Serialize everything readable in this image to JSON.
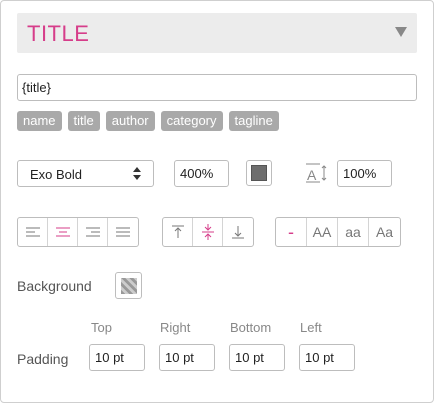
{
  "header": {
    "title": "TITLE"
  },
  "text_field": {
    "value": "{title}"
  },
  "tags": [
    "name",
    "title",
    "author",
    "category",
    "tagline"
  ],
  "font": {
    "family": "Exo Bold",
    "size": "400%",
    "line_height": "100%"
  },
  "colors": {
    "accent": "#d63d8a",
    "text_color": "#6e6e6e"
  },
  "alignment": {
    "options": [
      "align-left",
      "align-center",
      "align-right",
      "align-justify"
    ],
    "selected": "align-center"
  },
  "vertical_alignment": {
    "options": [
      "align-top",
      "align-middle",
      "align-bottom"
    ],
    "selected": "align-middle"
  },
  "text_case": {
    "options": [
      "-",
      "AA",
      "aa",
      "Aa"
    ],
    "selected": "-"
  },
  "background": {
    "label": "Background"
  },
  "padding": {
    "label": "Padding",
    "top_label": "Top",
    "right_label": "Right",
    "bottom_label": "Bottom",
    "left_label": "Left",
    "top": "10 pt",
    "right": "10 pt",
    "bottom": "10 pt",
    "left": "10 pt"
  }
}
